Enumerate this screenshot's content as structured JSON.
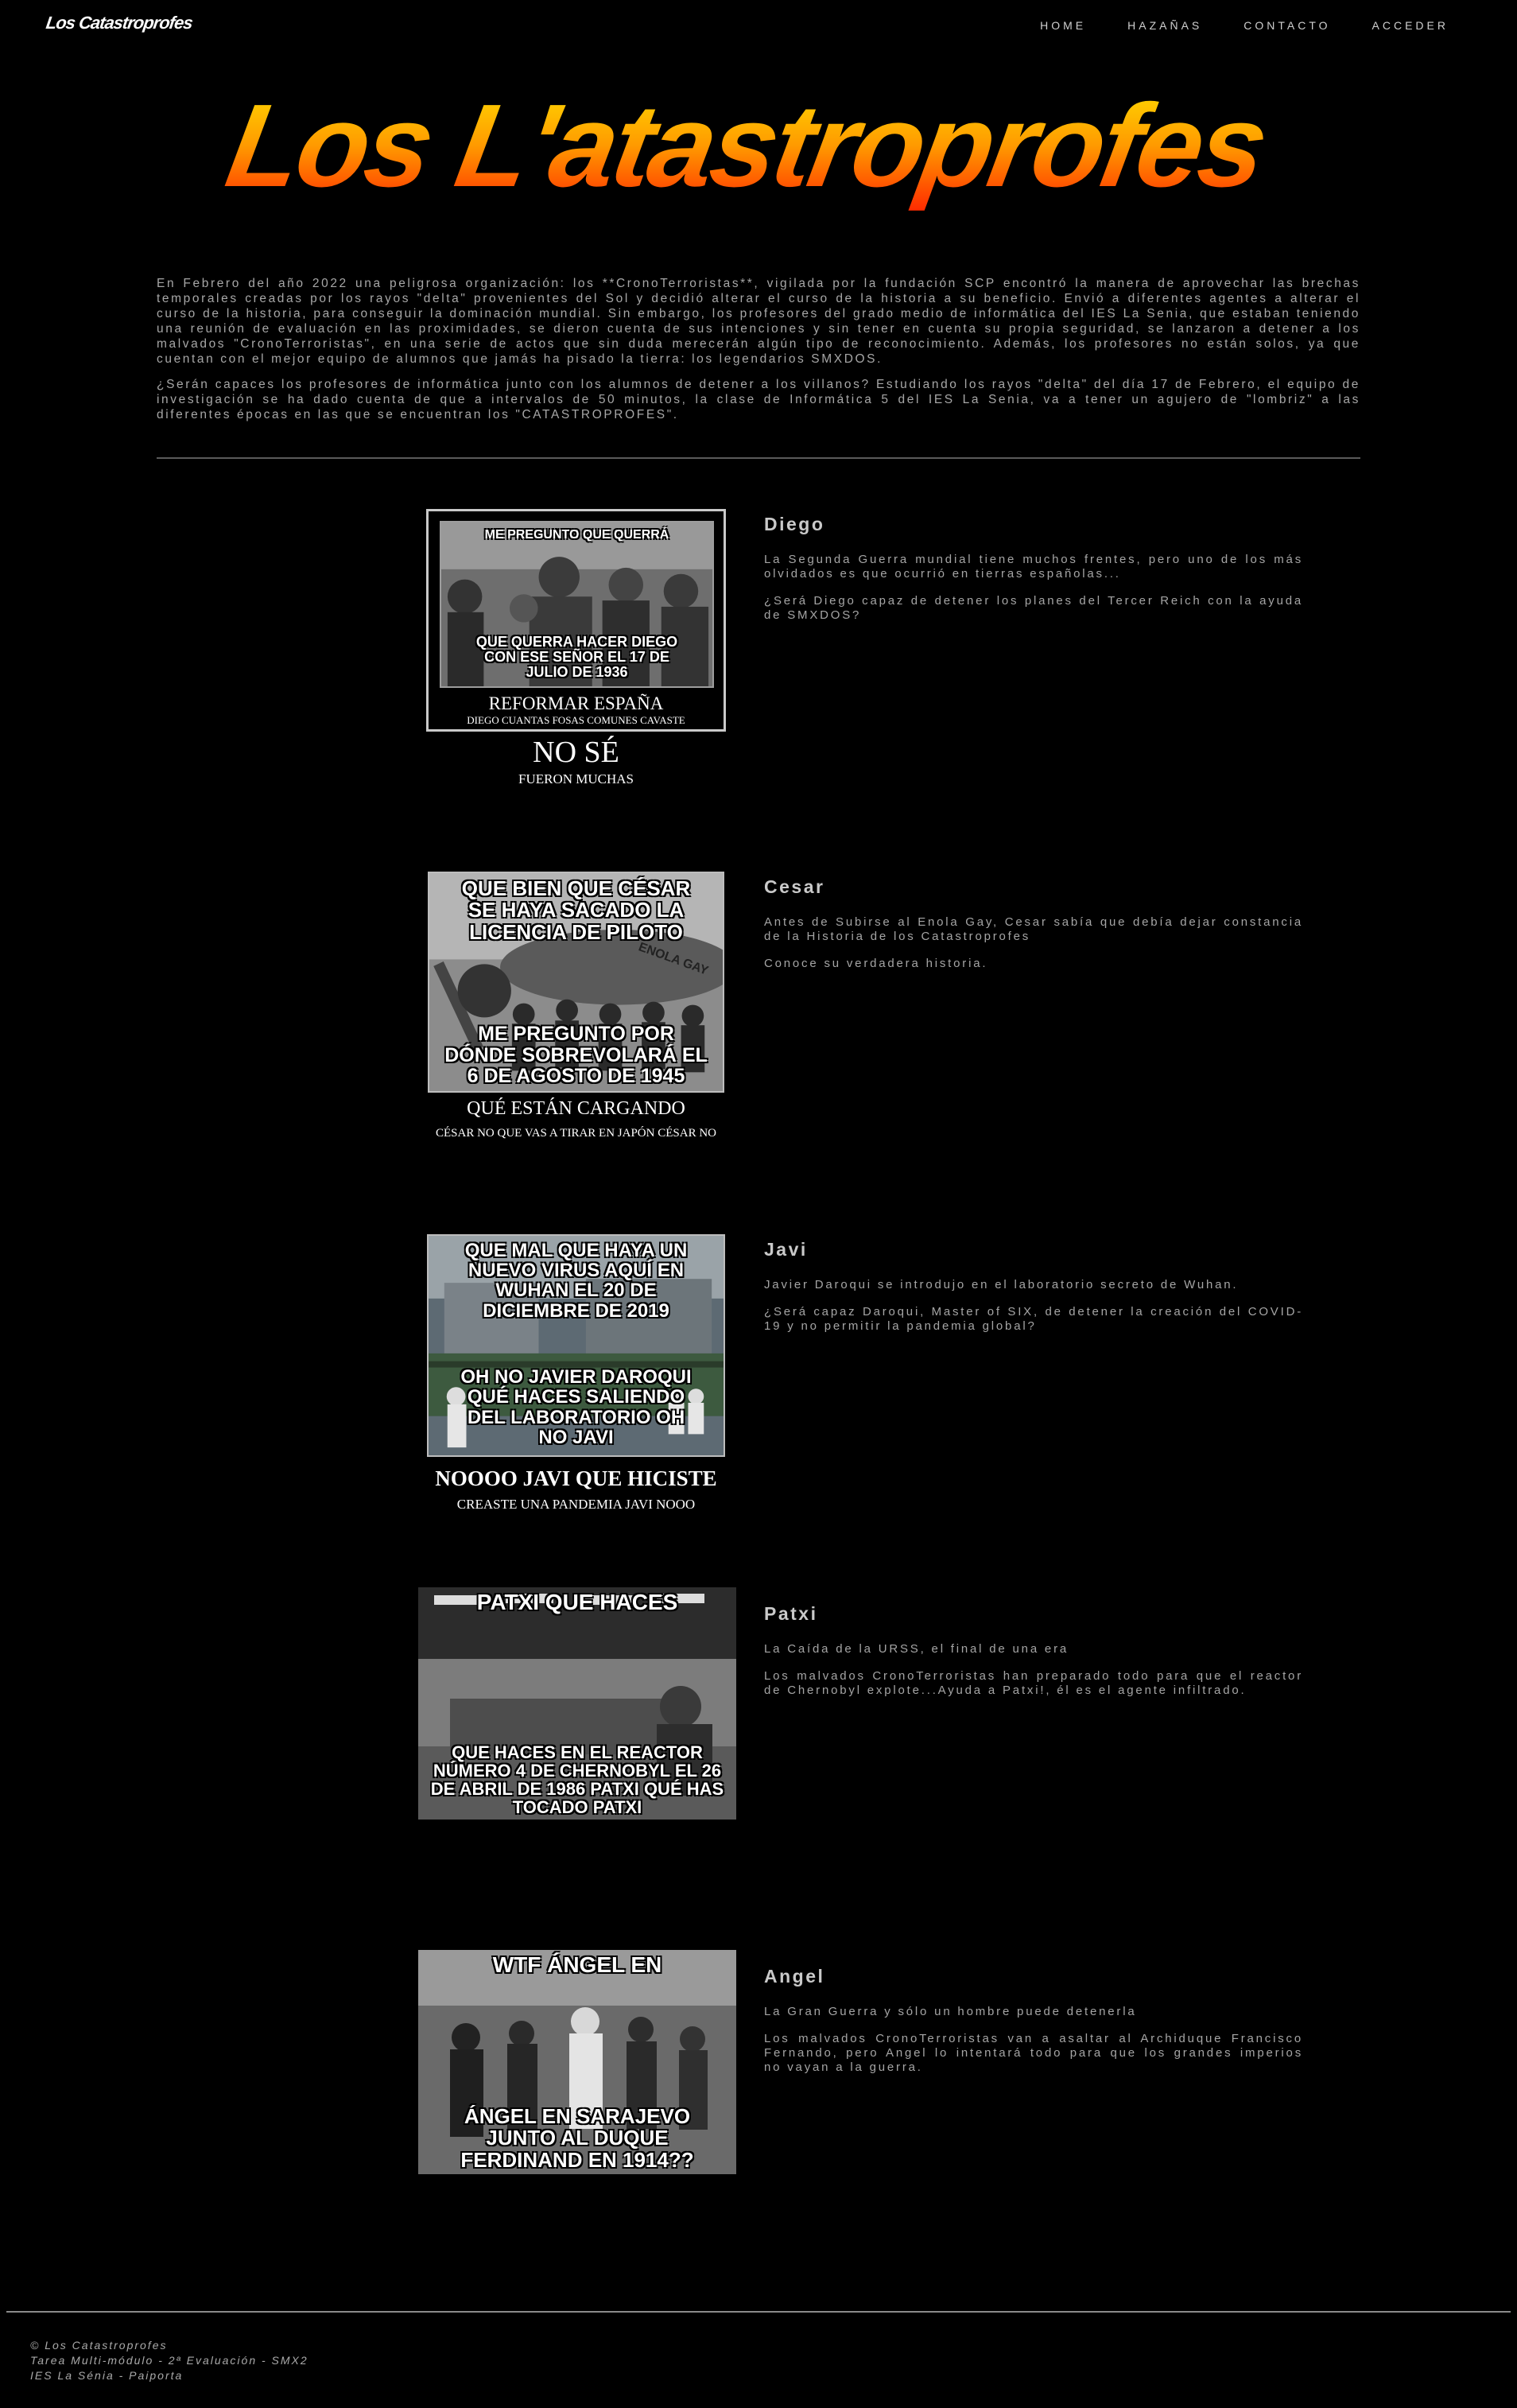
{
  "site": {
    "logo_small": "Los Catastroprofes",
    "hero_title": "Los L'atastroprofes"
  },
  "nav": {
    "items": [
      "HOME",
      "HAZAÑAS",
      "CONTACTO",
      "ACCEDER"
    ]
  },
  "intro": {
    "p1": "En Febrero del año 2022 una peligrosa organización: los **CronoTerroristas**, vigilada por la fundación SCP encontró la manera de aprovechar las brechas temporales creadas por los rayos \"delta\" provenientes del Sol y decidió alterar el curso de la historia a su beneficio. Envió a diferentes agentes a alterar el curso de la historia, para conseguir la dominación mundial. Sin embargo, los profesores del grado medio de informática del IES La Senia, que estaban teniendo una reunión de evaluación en las proximidades, se dieron cuenta de sus intenciones y sin tener en cuenta su propia seguridad, se lanzaron a detener a los malvados \"CronoTerroristas\", en una serie de actos que sin duda merecerán algún tipo de reconocimiento. Además, los profesores no están solos, ya que cuentan con el mejor equipo de alumnos que jamás ha pisado la tierra: los legendarios SMXDOS.",
    "p2": "¿Serán capaces los profesores de informática junto con los alumnos de detener a los villanos? Estudiando los rayos \"delta\" del día 17 de Febrero, el equipo de investigación se ha dado cuenta de que a intervalos de 50 minutos, la clase de Informática 5 del IES La Senia, va a tener un agujero de \"lombriz\" a las diferentes épocas en las que se encuentran los \"CATASTROPROFES\"."
  },
  "sections": [
    {
      "name": "Diego",
      "p1": "La Segunda Guerra mundial tiene muchos frentes, pero uno de los más olvidados es que ocurrió en tierras españolas...",
      "p2": "¿Será Diego capaz de detener los planes del Tercer Reich con la ayuda de SMXDOS?",
      "meme_top": "ME PREGUNTO QUE QUERRÁ",
      "meme_bottom": "QUE QUERRA HACER DIEGO CON ESE SEÑOR EL 17 DE JULIO DE 1936",
      "frame_title": "REFORMAR ESPAÑA",
      "frame_sub": "DIEGO CUANTAS FOSAS COMUNES CAVASTE",
      "below_title": "NO SÉ",
      "below_sub": "FUERON MUCHAS"
    },
    {
      "name": "Cesar",
      "p1": "Antes de Subirse al Enola Gay, Cesar sabía que debía dejar constancia de la Historia de los Catastroprofes",
      "p2": "Conoce su verdadera historia.",
      "meme_top": "QUE BIEN QUE CÉSAR SE HAYA SACADO LA LICENCIA DE PILOTO",
      "meme_bottom": "ME PREGUNTO POR DÓNDE SOBREVOLARÁ EL 6 DE AGOSTO DE 1945",
      "plane_label": "ENOLA GAY",
      "below_title": "QUÉ ESTÁN CARGANDO",
      "below_sub": "CÉSAR NO QUE VAS A TIRAR EN JAPÓN CÉSAR NO"
    },
    {
      "name": "Javi",
      "p1": "Javier Daroqui se introdujo en el laboratorio secreto de Wuhan.",
      "p2": "¿Será capaz Daroqui, Master of SIX, de detener la creación del COVID-19 y no permitir la pandemia global?",
      "meme_top": "QUE MAL QUE HAYA UN NUEVO VIRUS AQUÍ EN WUHAN EL 20 DE DICIEMBRE DE 2019",
      "meme_bottom": "OH NO JAVIER DAROQUI QUÉ HACES SALIENDO DEL LABORATORIO OH NO JAVI",
      "below_title": "NOOOO JAVI QUE HICISTE",
      "below_sub": "CREASTE UNA PANDEMIA JAVI NOOO"
    },
    {
      "name": "Patxi",
      "p1": "La Caída de la URSS, el final de una era",
      "p2": "Los malvados CronoTerroristas han preparado todo para que el reactor de Chernobyl explote...Ayuda a Patxi!, él es el agente infiltrado.",
      "meme_top": "PATXI QUE HACES",
      "meme_bottom": "QUE HACES EN EL REACTOR NÚMERO 4 DE CHERNOBYL EL 26 DE ABRIL DE 1986 PATXI QUÉ HAS TOCADO PATXI"
    },
    {
      "name": "Angel",
      "p1": "La Gran Guerra y sólo un hombre puede detenerla",
      "p2": "Los malvados CronoTerroristas van a asaltar al Archiduque Francisco Fernando, pero Angel lo intentará todo para que los grandes imperios no vayan a la guerra.",
      "meme_top": "WTF ÁNGEL EN",
      "meme_bottom": "ÁNGEL EN SARAJEVO JUNTO AL DUQUE FERDINAND EN 1914??"
    }
  ],
  "footer": {
    "line1": "© Los Catastroprofes",
    "line2": "Tarea Multi-módulo - 2ª Evaluación - SMX2",
    "line3": "IES La Sénia - Paiporta"
  },
  "colors": {
    "background": "#000000",
    "title_gradient_top": "#ffe000",
    "title_gradient_bottom": "#ff2a00"
  }
}
